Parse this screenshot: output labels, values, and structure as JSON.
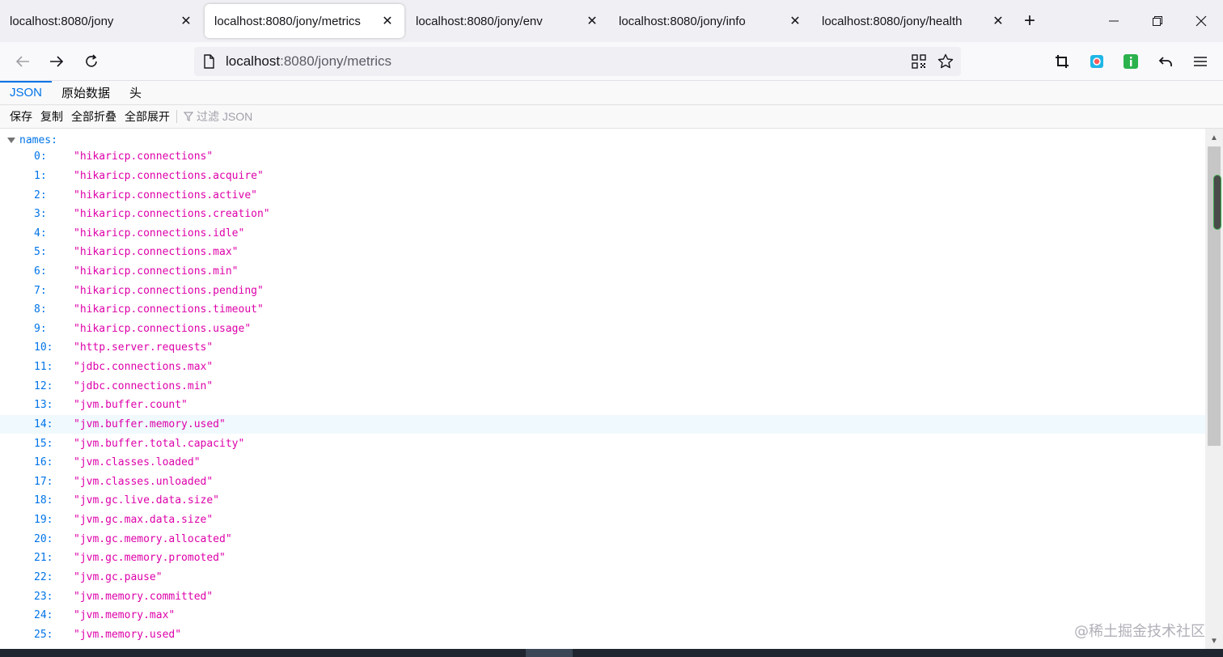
{
  "tabs": [
    {
      "title": "localhost:8080/jony",
      "active": false
    },
    {
      "title": "localhost:8080/jony/metrics",
      "active": true
    },
    {
      "title": "localhost:8080/jony/env",
      "active": false
    },
    {
      "title": "localhost:8080/jony/info",
      "active": false
    },
    {
      "title": "localhost:8080/jony/health",
      "active": false
    }
  ],
  "urlbar": {
    "host": "localhost",
    "rest": ":8080/jony/metrics"
  },
  "viewer_tabs": [
    "JSON",
    "原始数据",
    "头"
  ],
  "toolbar": {
    "save": "保存",
    "copy": "复制",
    "collapse_all": "全部折叠",
    "expand_all": "全部展开",
    "filter_placeholder": "过滤 JSON"
  },
  "json": {
    "root_key": "names:",
    "items": [
      {
        "index": "0:",
        "value": "\"hikaricp.connections\""
      },
      {
        "index": "1:",
        "value": "\"hikaricp.connections.acquire\""
      },
      {
        "index": "2:",
        "value": "\"hikaricp.connections.active\""
      },
      {
        "index": "3:",
        "value": "\"hikaricp.connections.creation\""
      },
      {
        "index": "4:",
        "value": "\"hikaricp.connections.idle\""
      },
      {
        "index": "5:",
        "value": "\"hikaricp.connections.max\""
      },
      {
        "index": "6:",
        "value": "\"hikaricp.connections.min\""
      },
      {
        "index": "7:",
        "value": "\"hikaricp.connections.pending\""
      },
      {
        "index": "8:",
        "value": "\"hikaricp.connections.timeout\""
      },
      {
        "index": "9:",
        "value": "\"hikaricp.connections.usage\""
      },
      {
        "index": "10:",
        "value": "\"http.server.requests\""
      },
      {
        "index": "11:",
        "value": "\"jdbc.connections.max\""
      },
      {
        "index": "12:",
        "value": "\"jdbc.connections.min\""
      },
      {
        "index": "13:",
        "value": "\"jvm.buffer.count\""
      },
      {
        "index": "14:",
        "value": "\"jvm.buffer.memory.used\"",
        "highlighted": true
      },
      {
        "index": "15:",
        "value": "\"jvm.buffer.total.capacity\""
      },
      {
        "index": "16:",
        "value": "\"jvm.classes.loaded\""
      },
      {
        "index": "17:",
        "value": "\"jvm.classes.unloaded\""
      },
      {
        "index": "18:",
        "value": "\"jvm.gc.live.data.size\""
      },
      {
        "index": "19:",
        "value": "\"jvm.gc.max.data.size\""
      },
      {
        "index": "20:",
        "value": "\"jvm.gc.memory.allocated\""
      },
      {
        "index": "21:",
        "value": "\"jvm.gc.memory.promoted\""
      },
      {
        "index": "22:",
        "value": "\"jvm.gc.pause\""
      },
      {
        "index": "23:",
        "value": "\"jvm.memory.committed\""
      },
      {
        "index": "24:",
        "value": "\"jvm.memory.max\""
      },
      {
        "index": "25:",
        "value": "\"jvm.memory.used\""
      }
    ]
  },
  "watermark": "@稀土掘金技术社区",
  "colors": {
    "key": "#0074e8",
    "string": "#dd00a9",
    "highlight_row": "#f0f9fe"
  }
}
